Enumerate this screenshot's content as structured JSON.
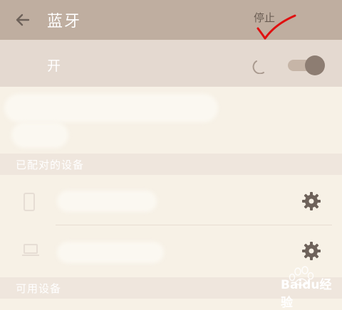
{
  "appbar": {
    "title": "蓝牙",
    "stop_label": "停止"
  },
  "toggle": {
    "label": "开",
    "state": "on"
  },
  "sections": {
    "paired_label": "已配对的设备",
    "available_label": "可用设备"
  },
  "paired_devices": [
    {
      "type": "phone"
    },
    {
      "type": "laptop"
    }
  ],
  "watermark": {
    "text": "Baidu经验"
  },
  "colors": {
    "appbar": "#bfaea0",
    "toggle_row": "#e4d9d0",
    "background": "#f7f1e6",
    "section_header": "#efe6dd",
    "icon_gray": "#6e625a",
    "check_mark": "#e01010"
  }
}
